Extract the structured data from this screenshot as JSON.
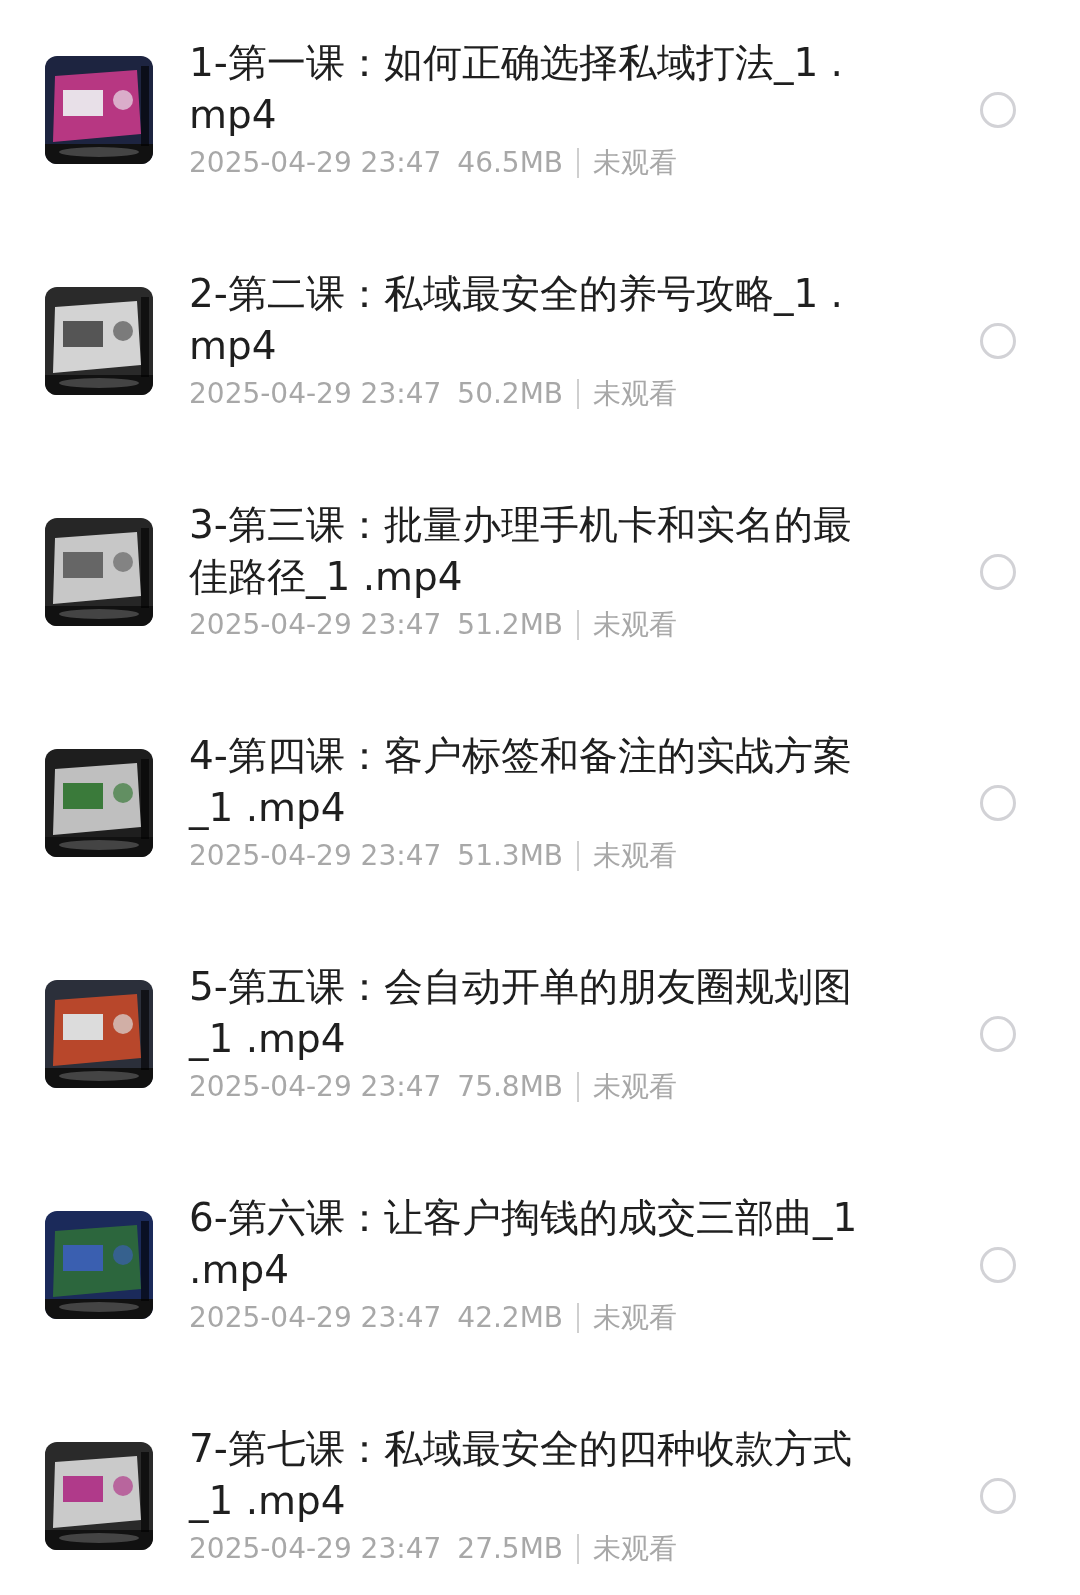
{
  "files": [
    {
      "title": "1-第一课：如何正确选择私域打法_1 .mp4",
      "date": "2025-04-29 23:47",
      "size": "46.5MB",
      "status": "未观看",
      "selected": false
    },
    {
      "title": "2-第二课：私域最安全的养号攻略_1 .mp4",
      "date": "2025-04-29 23:47",
      "size": "50.2MB",
      "status": "未观看",
      "selected": false
    },
    {
      "title": "3-第三课：批量办理手机卡和实名的最佳路径_1 .mp4",
      "date": "2025-04-29 23:47",
      "size": "51.2MB",
      "status": "未观看",
      "selected": false
    },
    {
      "title": "4-第四课：客户标签和备注的实战方案_1 .mp4",
      "date": "2025-04-29 23:47",
      "size": "51.3MB",
      "status": "未观看",
      "selected": false
    },
    {
      "title": "5-第五课：会自动开单的朋友圈规划图_1 .mp4",
      "date": "2025-04-29 23:47",
      "size": "75.8MB",
      "status": "未观看",
      "selected": false
    },
    {
      "title": "6-第六课：让客户掏钱的成交三部曲_1 .mp4",
      "date": "2025-04-29 23:47",
      "size": "42.2MB",
      "status": "未观看",
      "selected": false
    },
    {
      "title": "7-第七课：私域最安全的四种收款方式_1 .mp4",
      "date": "2025-04-29 23:47",
      "size": "27.5MB",
      "status": "未观看",
      "selected": false
    }
  ]
}
